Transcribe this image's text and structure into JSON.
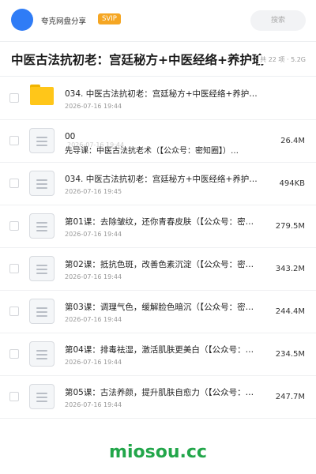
{
  "header": {
    "share_title": "夸克网盘分享",
    "badge": "SVIP",
    "search_placeholder": "搜索"
  },
  "folder": {
    "title": "中医古法抗初老：宫廷秘方+中医经络+养护瑜伽",
    "meta": "共 22 项 · 5.2G"
  },
  "files": [
    {
      "name": "034. 中医古法抗初老：宫廷秘方+中医经络+养护…",
      "date": "2026-07-16 19:44",
      "size": "",
      "icon": "folder-icon"
    },
    {
      "name": "00",
      "subname": "先导课：中医古法抗老术（【公众号：密知圈】）…",
      "date": "2026-07-16 19:44",
      "size": "26.4M",
      "icon": "document-icon"
    },
    {
      "name": "034. 中医古法抗初老：宫廷秘方+中医经络+养护…",
      "date": "2026-07-16 19:45",
      "size": "494KB",
      "icon": "document-icon"
    },
    {
      "name": "第01课：去除皱纹，还你青春皮肤（【公众号：密知圈…",
      "date": "2026-07-16 19:44",
      "size": "279.5M",
      "icon": "document-icon"
    },
    {
      "name": "第02课：抵抗色斑，改善色素沉淀（【公众号：密知圈…",
      "date": "2026-07-16 19:44",
      "size": "343.2M",
      "icon": "document-icon"
    },
    {
      "name": "第03课：调理气色，缓解脸色暗沉（【公众号：密知圈…",
      "date": "2026-07-16 19:44",
      "size": "244.4M",
      "icon": "document-icon"
    },
    {
      "name": "第04课：排毒祛湿，激活肌肤更美白（【公众号：密知…",
      "date": "2026-07-16 19:44",
      "size": "234.5M",
      "icon": "document-icon"
    },
    {
      "name": "第05课：古法养颜，提升肌肤自愈力（【公众号：密知…",
      "date": "2026-07-16 19:44",
      "size": "247.7M",
      "icon": "document-icon"
    }
  ],
  "watermark": "miosou.cc",
  "colors": {
    "accent": "#2f7cf6",
    "badge": "#f5a623",
    "folder": "#ffc619",
    "watermark": "#22a64a"
  }
}
